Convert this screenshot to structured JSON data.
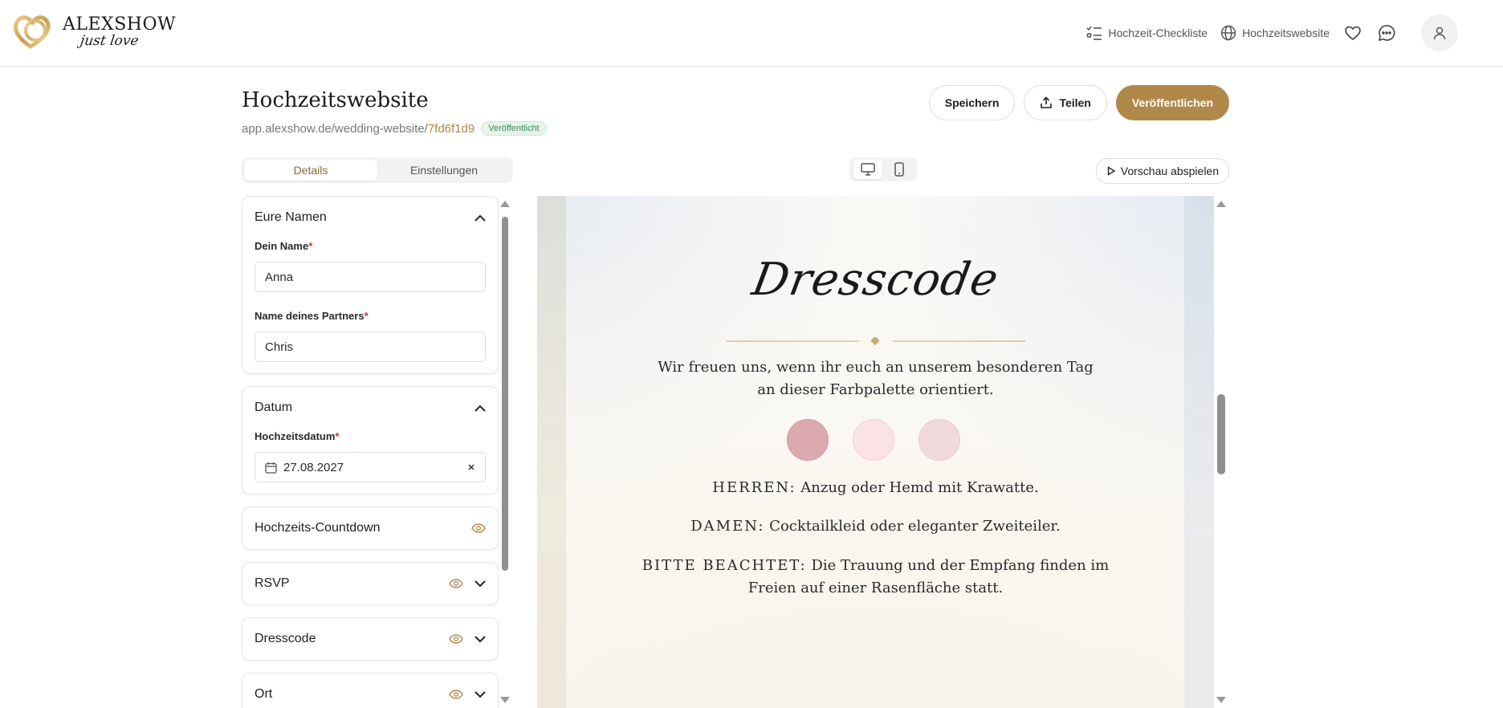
{
  "brand": {
    "name": "ALEXSHOW",
    "tagline": "just love"
  },
  "topnav": {
    "checklist_label": "Hochzeit-Checkliste",
    "website_label": "Hochzeitswebsite"
  },
  "page": {
    "title": "Hochzeitswebsite",
    "url_base": "app.alexshow.de/wedding-website/",
    "url_slug": "7fd6f1d9",
    "status_badge": "Veröffentlicht"
  },
  "actions": {
    "save": "Speichern",
    "share": "Teilen",
    "publish": "Veröffentlichen"
  },
  "tabs": [
    {
      "label": "Details",
      "active": true
    },
    {
      "label": "Einstellungen",
      "active": false
    }
  ],
  "preview_button": "Vorschau abspielen",
  "sections": {
    "names": {
      "title": "Eure Namen",
      "your_name_label": "Dein Name",
      "your_name_value": "Anna",
      "partner_label": "Name deines Partners",
      "partner_value": "Chris"
    },
    "date": {
      "title": "Datum",
      "date_label": "Hochzeitsdatum",
      "date_value": "27.08.2027"
    },
    "countdown": {
      "title": "Hochzeits-Countdown"
    },
    "rsvp": {
      "title": "RSVP"
    },
    "dresscode": {
      "title": "Dresscode"
    },
    "location": {
      "title": "Ort"
    }
  },
  "required_marker": "*",
  "preview": {
    "heading": "Dresscode",
    "intro": "Wir freuen uns, wenn ihr euch an unserem besonderen Tag an dieser Farbpalette orientiert.",
    "swatches": [
      "#dca9af",
      "#fbe3e5",
      "#f0d9db"
    ],
    "rules": [
      {
        "label": "HERREN:",
        "text": "Anzug oder Hemd mit Krawatte."
      },
      {
        "label": "DAMEN:",
        "text": "Cocktailkleid oder eleganter Zweiteiler."
      },
      {
        "label": "BITTE BEACHTET:",
        "text": "Die Trauung und der Empfang finden im Freien auf einer Rasenfläche statt."
      }
    ]
  },
  "colors": {
    "accent": "#b0894a",
    "required": "#d0332c",
    "badge_green": "#3c8a5a"
  }
}
